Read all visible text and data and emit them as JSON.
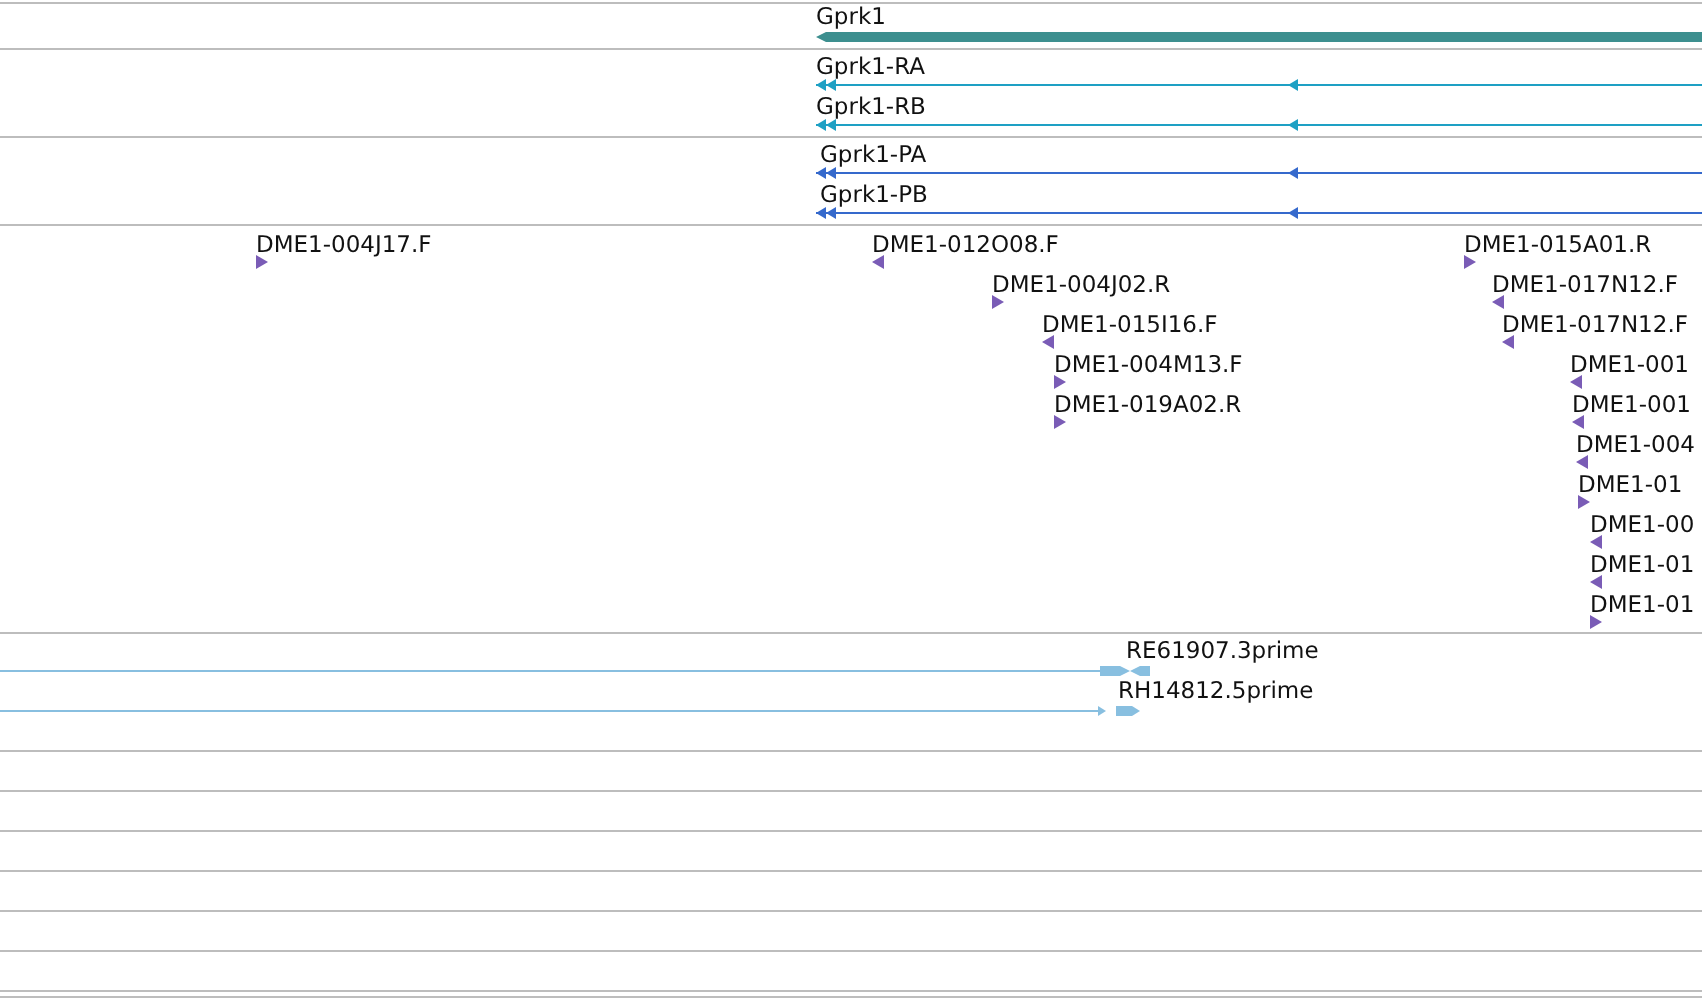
{
  "tracks": [
    {
      "kind": "gene",
      "features": [
        {
          "label": "Gprk1",
          "reverse": true
        }
      ]
    },
    {
      "kind": "transcript",
      "features": [
        {
          "label": "Gprk1-RA",
          "reverse": true
        },
        {
          "label": "Gprk1-RB",
          "reverse": true
        }
      ]
    },
    {
      "kind": "protein",
      "features": [
        {
          "label": "Gprk1-PA",
          "reverse": true
        },
        {
          "label": "Gprk1-PB",
          "reverse": true
        }
      ]
    },
    {
      "kind": "est",
      "features": [
        {
          "label": "DME1-004J17.F",
          "reverse": false
        },
        {
          "label": "DME1-012O08.F",
          "reverse": true
        },
        {
          "label": "DME1-004J02.R",
          "reverse": false
        },
        {
          "label": "DME1-015I16.F",
          "reverse": true
        },
        {
          "label": "DME1-004M13.F",
          "reverse": false
        },
        {
          "label": "DME1-019A02.R",
          "reverse": false
        },
        {
          "label": "DME1-015A01.R",
          "reverse": false
        },
        {
          "label": "DME1-017N12.F",
          "reverse": true
        },
        {
          "label": "DME1-017N12.F",
          "reverse": true
        },
        {
          "label": "DME1-001",
          "reverse": true
        },
        {
          "label": "DME1-001",
          "reverse": true
        },
        {
          "label": "DME1-004",
          "reverse": true
        },
        {
          "label": "DME1-01",
          "reverse": false
        },
        {
          "label": "DME1-00",
          "reverse": true
        },
        {
          "label": "DME1-01",
          "reverse": true
        },
        {
          "label": "DME1-01",
          "reverse": false
        }
      ]
    },
    {
      "kind": "cdna",
      "features": [
        {
          "label": "RE61907.3prime",
          "reverse": false
        },
        {
          "label": "RH14812.5prime",
          "reverse": false
        }
      ]
    }
  ]
}
